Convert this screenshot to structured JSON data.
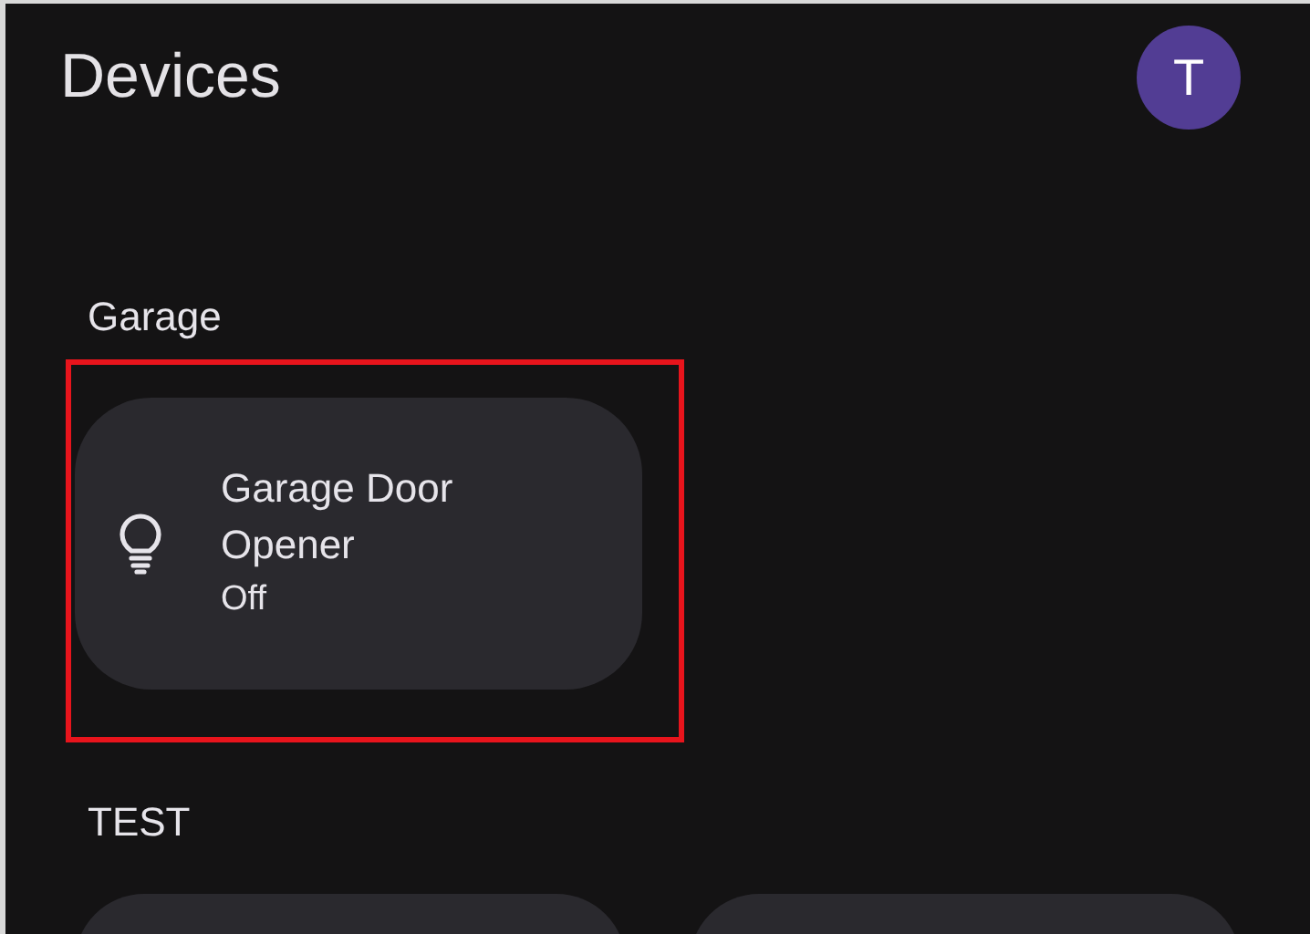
{
  "header": {
    "title": "Devices",
    "avatar": {
      "initial": "T"
    }
  },
  "sections": [
    {
      "title": "Garage",
      "devices": [
        {
          "kind": "light",
          "name": "Garage Door Opener",
          "status": "Off",
          "highlighted": true
        }
      ]
    },
    {
      "title": "TEST",
      "devices": [
        {
          "kind": "cut"
        },
        {
          "kind": "cut"
        }
      ]
    }
  ]
}
